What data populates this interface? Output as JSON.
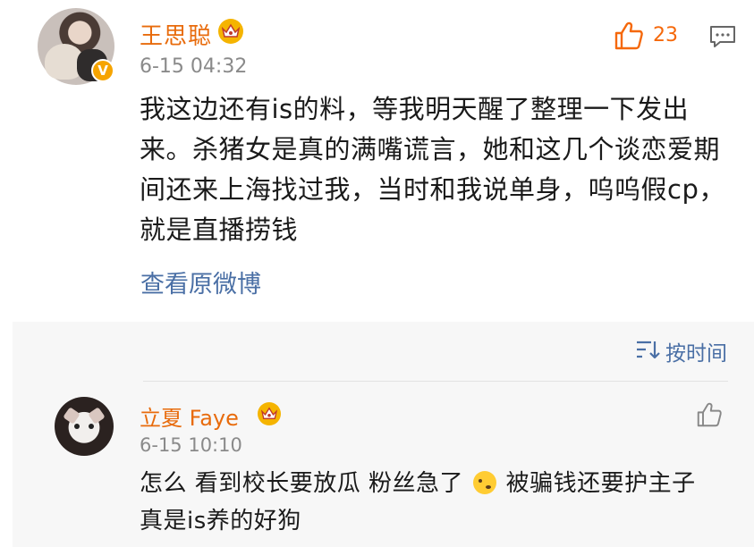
{
  "post": {
    "author": "王思聪",
    "time": "6-15 04:32",
    "like_count": "23",
    "text": "我这边还有is的料，等我明天醒了整理一下发出来。杀猪女是真的满嘴谎言，她和这几个谈恋爱期间还来上海找过我，当时和我说单身，呜呜假cp，就是直播捞钱",
    "view_original": "查看原微博",
    "verified_badge": "V"
  },
  "comments": {
    "sort_label": "按时间",
    "items": [
      {
        "author": "立夏 Faye",
        "time": "6-15 10:10",
        "text_before_emoji": "怎么 看到校长要放瓜 粉丝急了",
        "text_after_emoji": "被骗钱还要护主子 真是is养的好狗"
      }
    ]
  },
  "colors": {
    "name_orange": "#e86b0c",
    "like_orange": "#f5680a",
    "link_blue": "#4a6fa5",
    "gray": "#8a8a8a"
  },
  "icons": [
    "crown-icon",
    "thumbs-up-icon",
    "comment-icon",
    "sort-icon",
    "emoji-thinking-icon"
  ]
}
